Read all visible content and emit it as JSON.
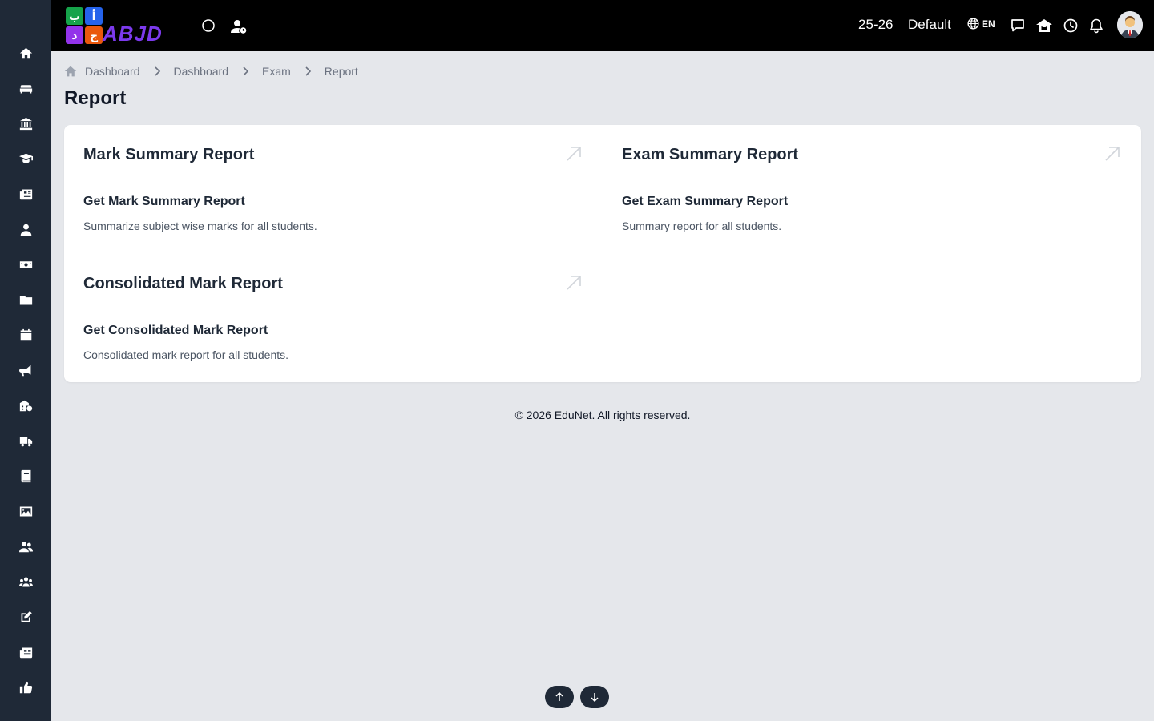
{
  "brand": {
    "logo_text": "ABJD",
    "tile_glyphs": [
      "ب",
      "أ",
      "د",
      "ج"
    ],
    "tile_colors": [
      "#16a34a",
      "#2563eb",
      "#9333ea",
      "#ea580c"
    ]
  },
  "header": {
    "session": "25-26",
    "profile": "Default",
    "language": "EN"
  },
  "sidebar": {
    "items": [
      {
        "name": "home-icon"
      },
      {
        "name": "sofa-icon"
      },
      {
        "name": "institution-icon"
      },
      {
        "name": "graduate-icon"
      },
      {
        "name": "newspaper-icon"
      },
      {
        "name": "user-icon"
      },
      {
        "name": "money-icon"
      },
      {
        "name": "folder-icon"
      },
      {
        "name": "calendar-icon"
      },
      {
        "name": "megaphone-icon"
      },
      {
        "name": "school-settings-icon"
      },
      {
        "name": "truck-icon"
      },
      {
        "name": "book-icon"
      },
      {
        "name": "image-icon"
      },
      {
        "name": "users-icon"
      },
      {
        "name": "group-icon"
      },
      {
        "name": "edit-icon"
      },
      {
        "name": "news-icon"
      },
      {
        "name": "thumbs-up-icon"
      }
    ]
  },
  "breadcrumb": [
    "Dashboard",
    "Dashboard",
    "Exam",
    "Report"
  ],
  "page": {
    "title": "Report"
  },
  "reports": [
    {
      "title": "Mark Summary Report",
      "link": "Get Mark Summary Report",
      "description": "Summarize subject wise marks for all students."
    },
    {
      "title": "Exam Summary Report",
      "link": "Get Exam Summary Report",
      "description": "Summary report for all students."
    },
    {
      "title": "Consolidated Mark Report",
      "link": "Get Consolidated Mark Report",
      "description": "Consolidated mark report for all students."
    }
  ],
  "footer": {
    "text": "© 2026 EduNet. All rights reserved."
  },
  "colors": {
    "sidebar": "#1f2937",
    "topbar": "#000000",
    "background": "#e5e7eb",
    "card": "#ffffff"
  }
}
